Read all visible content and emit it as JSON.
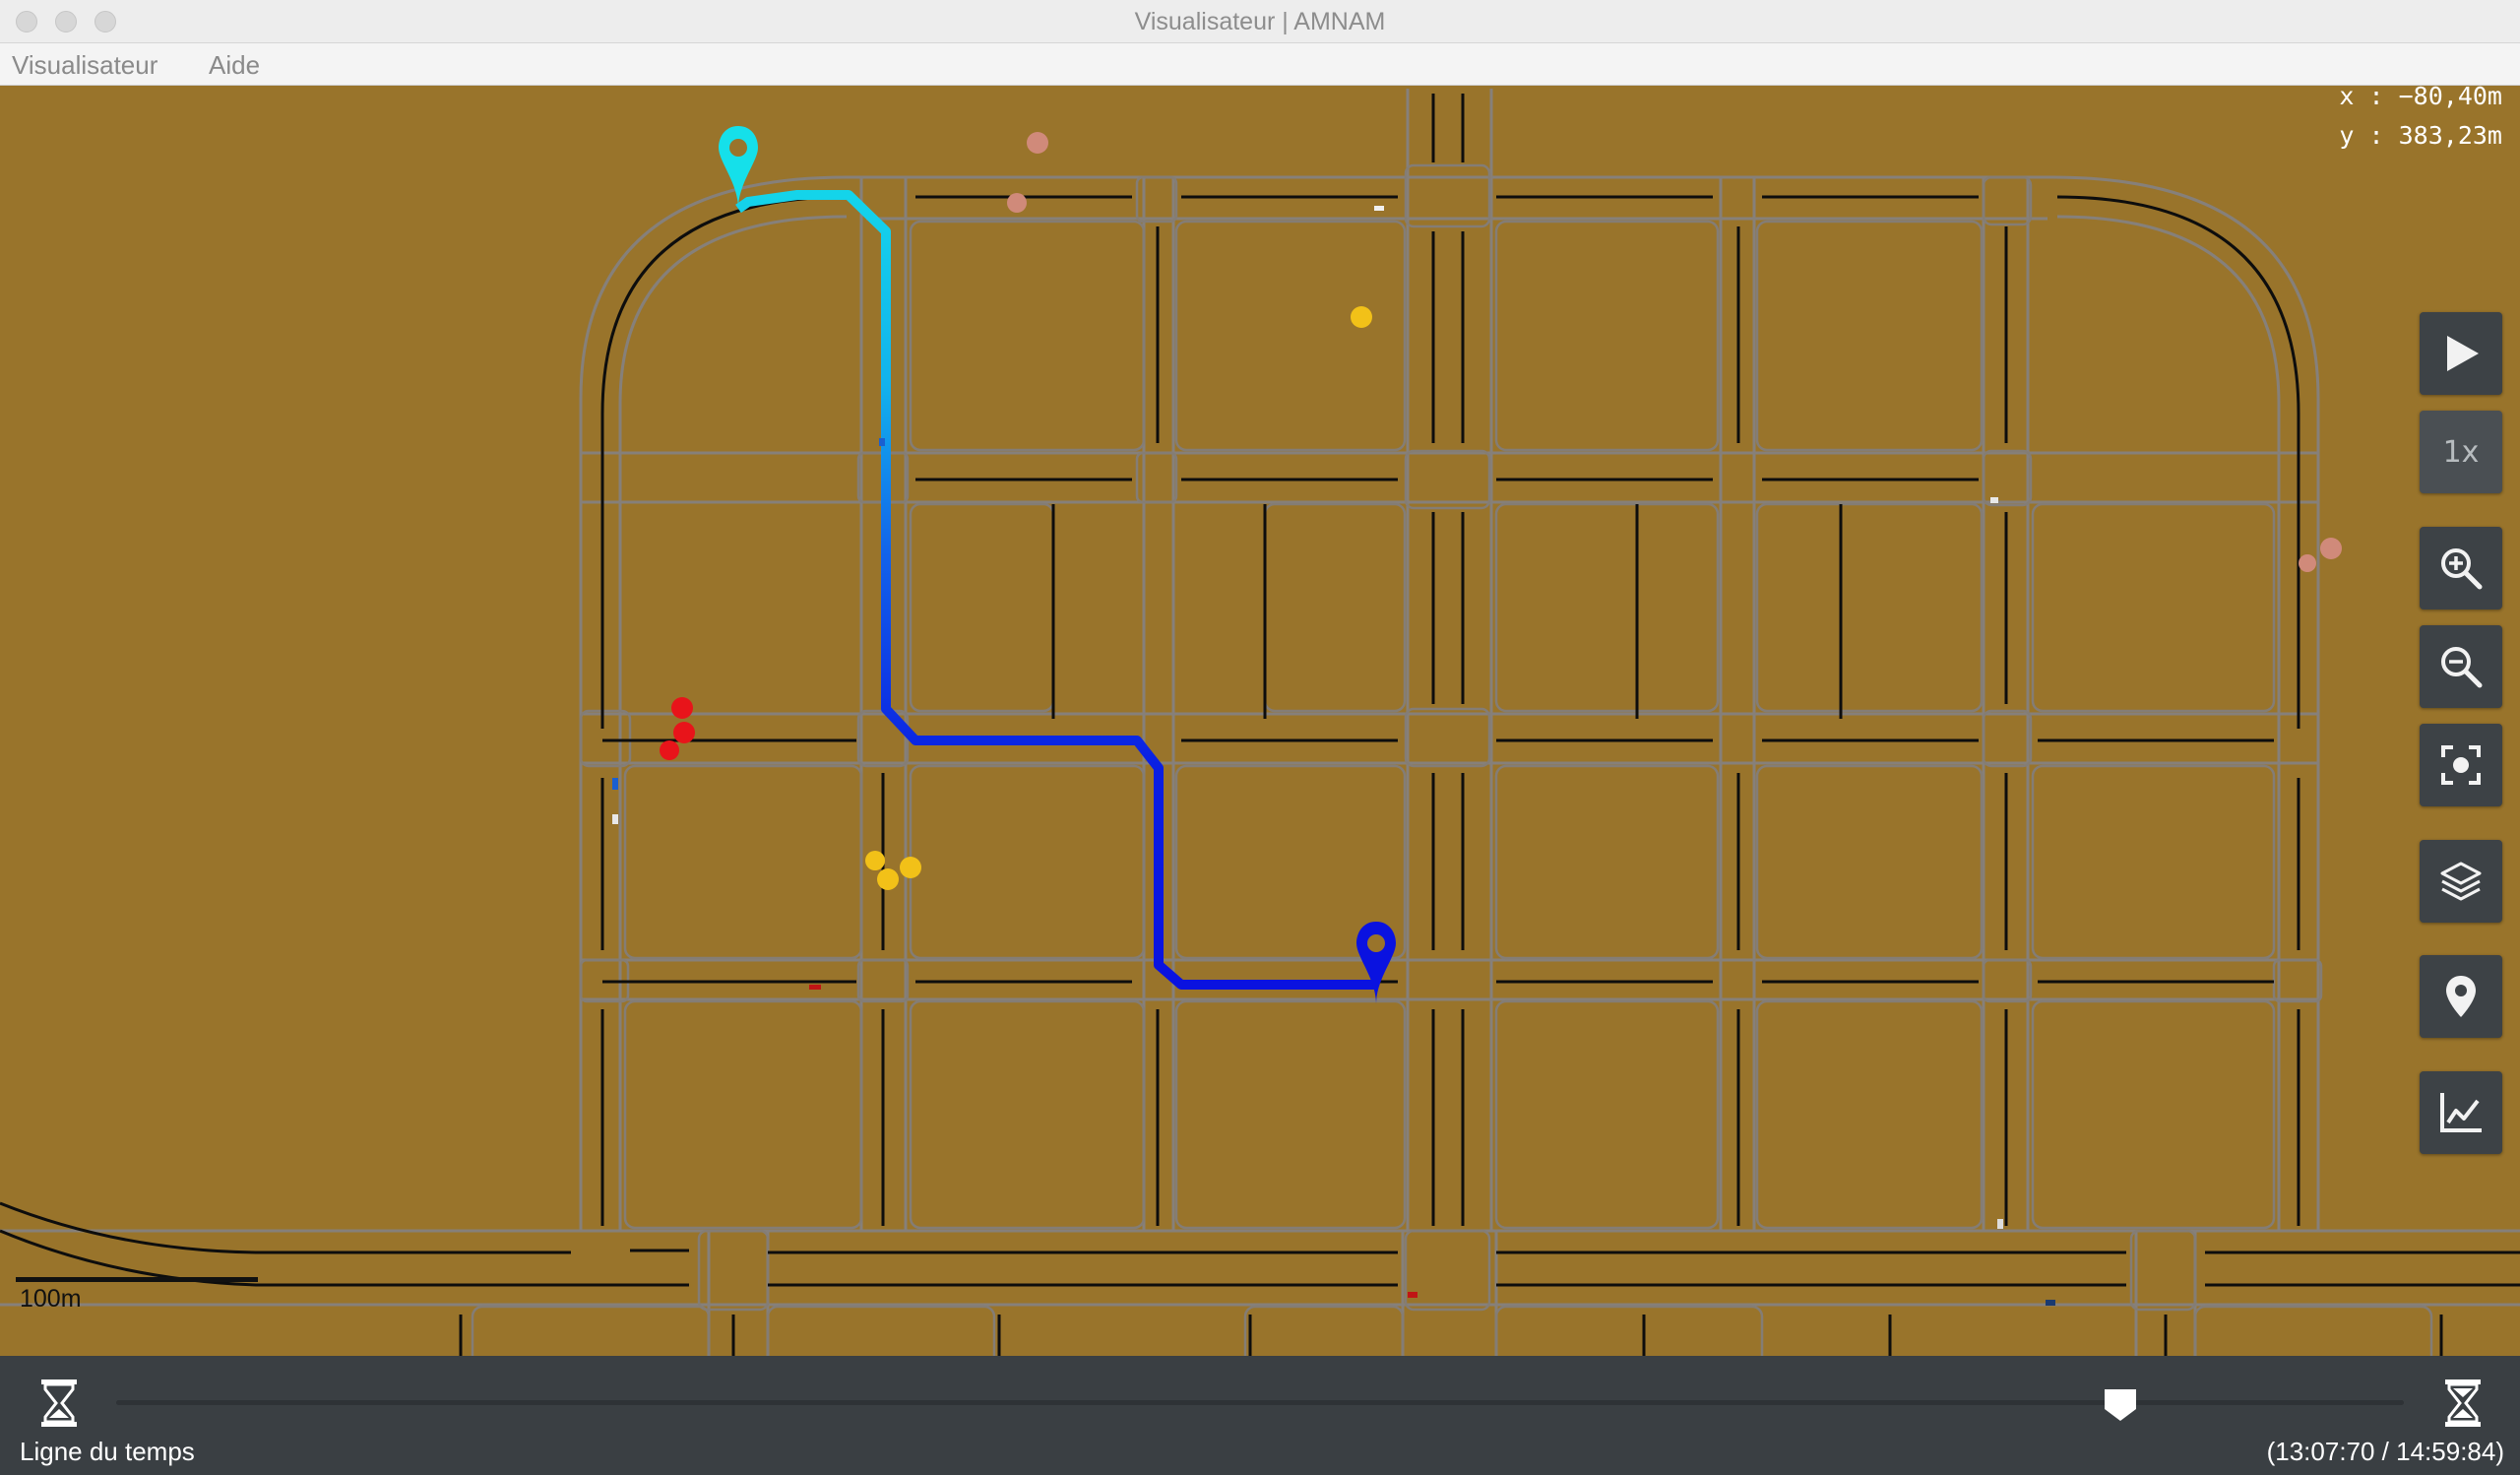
{
  "window": {
    "title": "Visualisateur | AMNAM"
  },
  "menu": {
    "items": [
      "Visualisateur",
      "Aide"
    ]
  },
  "map": {
    "cursor_x": "x : −80,40m",
    "cursor_y": "y : 383,23m",
    "scale_label": "100m",
    "route_start_color": "#15e0ea",
    "route_end_color": "#0a12e0"
  },
  "toolbar": {
    "buttons": [
      {
        "icon": "play-icon",
        "label": ""
      },
      {
        "icon": "speed",
        "label": "1x"
      },
      {
        "icon": "zoom-in-icon",
        "label": ""
      },
      {
        "icon": "zoom-out-icon",
        "label": ""
      },
      {
        "icon": "focus-icon",
        "label": ""
      },
      {
        "icon": "layers-icon",
        "label": ""
      },
      {
        "icon": "map-pin-icon",
        "label": ""
      },
      {
        "icon": "chart-icon",
        "label": ""
      }
    ]
  },
  "timeline": {
    "label": "Ligne du temps",
    "time": "(13:07:70 / 14:59:84)",
    "position": 0.876,
    "start_icon": "hourglass-icon",
    "end_icon": "hourglass-icon"
  }
}
